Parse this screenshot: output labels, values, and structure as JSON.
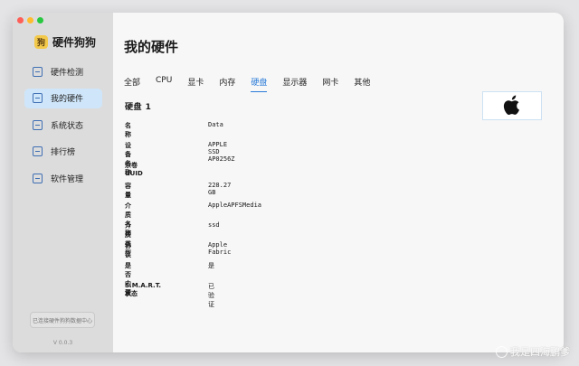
{
  "app": {
    "name": "硬件狗狗",
    "logo_text": "狗",
    "version": "V 0.0.3",
    "data_center_label": "已连接硬件狗狗数据中心"
  },
  "sidebar": {
    "items": [
      {
        "label": "硬件检测",
        "icon": "monitor-icon",
        "active": false
      },
      {
        "label": "我的硬件",
        "icon": "document-icon",
        "active": true
      },
      {
        "label": "系统状态",
        "icon": "cube-icon",
        "active": false
      },
      {
        "label": "排行榜",
        "icon": "chart-icon",
        "active": false
      },
      {
        "label": "软件管理",
        "icon": "apps-icon",
        "active": false
      }
    ]
  },
  "main": {
    "title": "我的硬件",
    "tabs": [
      "全部",
      "CPU",
      "显卡",
      "内存",
      "硬盘",
      "显示器",
      "网卡",
      "其他"
    ],
    "active_tab": "硬盘",
    "section_title": "硬盘 1",
    "properties": [
      {
        "label": "名称",
        "value": "Data"
      },
      {
        "label": "设备名称",
        "value": "APPLE SSD AP0256Z"
      },
      {
        "label": "宗卷UUID",
        "value": ""
      },
      {
        "label": "容量",
        "value": "228.27 GB"
      },
      {
        "label": "介质名称",
        "value": "AppleAPFSMedia"
      },
      {
        "label": "介质类型",
        "value": "ssd"
      },
      {
        "label": "协议",
        "value": "Apple Fabric"
      },
      {
        "label": "是否内置",
        "value": "是"
      },
      {
        "label": "S.M.A.R.T. 状态",
        "value": "已验证"
      }
    ],
    "brand_icon": "apple-logo-icon"
  },
  "watermark": {
    "text": "我是四海鹏爹"
  },
  "colors": {
    "accent": "#2a7bd8",
    "sidebar_bg": "#dcdcdc",
    "active_nav_bg": "#cfe6fa",
    "main_bg": "#f7f7f7"
  }
}
